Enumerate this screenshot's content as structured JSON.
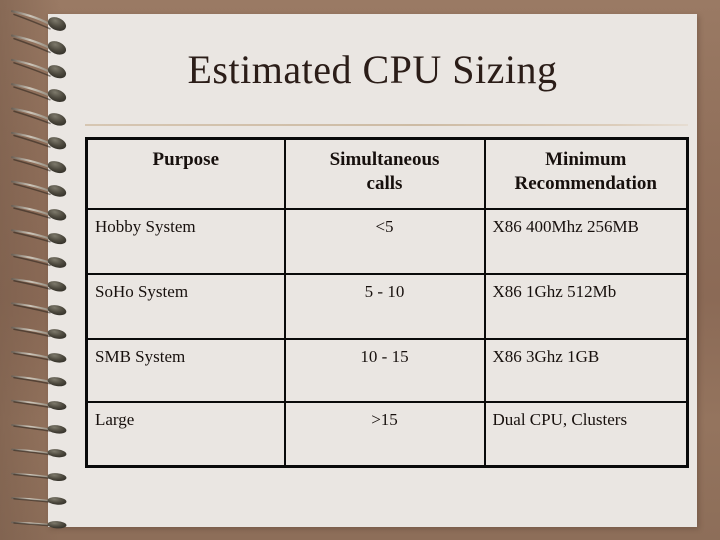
{
  "slide": {
    "title": "Estimated CPU Sizing",
    "page_background": "#eae6e2",
    "backdrop_color": "#91705b",
    "title_color": "#2b1d18",
    "divider_color": "#cdbba4",
    "table_border_color": "#0a0a0a"
  },
  "binding": {
    "icon": "spiral-binding-icon",
    "coil_count": 22,
    "wire_color": "#b9b0a4",
    "blob_color": "#4a463c"
  },
  "table": {
    "columns": [
      {
        "key": "purpose",
        "header": "Purpose"
      },
      {
        "key": "calls",
        "header": "Simultaneous\ncalls"
      },
      {
        "key": "rec",
        "header": "Minimum\nRecommendation"
      }
    ],
    "headers": {
      "purpose": "Purpose",
      "calls_line1": "Simultaneous",
      "calls_line2": "calls",
      "rec_line1": "Minimum",
      "rec_line2": "Recommendation"
    },
    "rows": [
      {
        "purpose": "Hobby System",
        "calls": "<5",
        "rec": "X86 400Mhz 256MB"
      },
      {
        "purpose": "SoHo System",
        "calls": "5 - 10",
        "rec": "X86 1Ghz 512Mb"
      },
      {
        "purpose": "SMB System",
        "calls": "10 - 15",
        "rec": "X86 3Ghz 1GB"
      },
      {
        "purpose": "Large",
        "calls": ">15",
        "rec": "Dual CPU, Clusters"
      }
    ]
  }
}
